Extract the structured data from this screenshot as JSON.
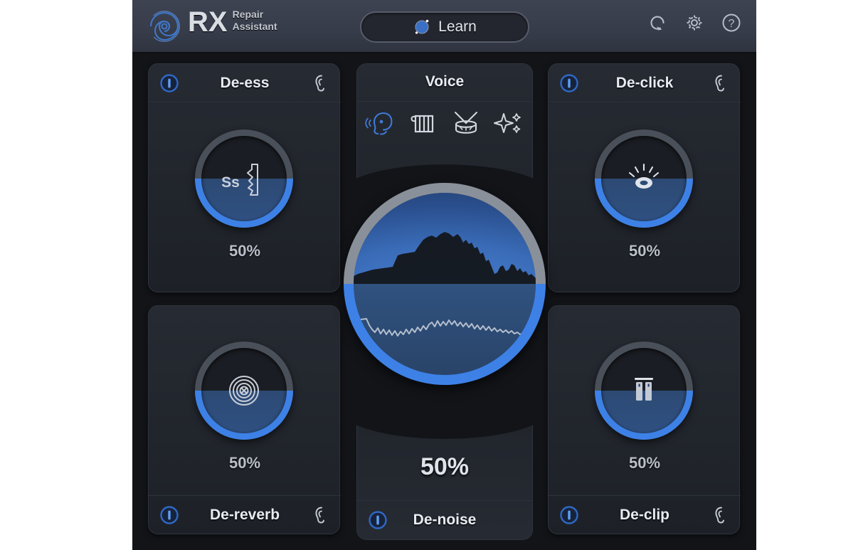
{
  "app": {
    "name": "RX Repair Assistant",
    "brand_accent": "#3d81e6",
    "background": "#121418",
    "header_background": "#373c4a"
  },
  "header": {
    "logo_mark": "rx-concentric-arcs-logo",
    "logo_primary": "RX",
    "logo_secondary_line1": "Repair",
    "logo_secondary_line2": "Assistant",
    "learn_button": {
      "label": "Learn",
      "icon": "learn-orb-icon"
    },
    "icons": [
      {
        "name": "reset-icon",
        "title": "Reset"
      },
      {
        "name": "gear-icon",
        "title": "Settings"
      },
      {
        "name": "help-icon",
        "title": "Help"
      }
    ]
  },
  "voice_panel": {
    "title": "Voice",
    "source_options": [
      {
        "name": "voice-icon",
        "label": "Voice",
        "selected": true
      },
      {
        "name": "piano-icon",
        "label": "Instrument",
        "selected": false
      },
      {
        "name": "drum-icon",
        "label": "Percussion",
        "selected": false
      },
      {
        "name": "sparkle-icon",
        "label": "Other",
        "selected": false
      }
    ]
  },
  "center_dial": {
    "ring_top_color": "#8a9099",
    "ring_bottom_color": "#3d81e6",
    "fill_percent": 50
  },
  "denoise_panel": {
    "value": "50%",
    "title": "De-noise",
    "power_on": true
  },
  "modules": [
    {
      "id": "de-ess",
      "position": "top-left",
      "title": "De-ess",
      "value": "50%",
      "percent": 50,
      "power_on": true,
      "power_icon": "power-icon",
      "solo_icon": "ear-icon",
      "knob_icon": "de-ess-icon",
      "bar_position": "top"
    },
    {
      "id": "de-click",
      "position": "top-right",
      "title": "De-click",
      "value": "50%",
      "percent": 50,
      "power_on": true,
      "power_icon": "power-icon",
      "solo_icon": "ear-icon",
      "knob_icon": "de-click-icon",
      "bar_position": "top"
    },
    {
      "id": "de-reverb",
      "position": "bottom-left",
      "title": "De-reverb",
      "value": "50%",
      "percent": 50,
      "power_on": true,
      "power_icon": "power-icon",
      "solo_icon": "ear-icon",
      "knob_icon": "de-reverb-icon",
      "bar_position": "bottom"
    },
    {
      "id": "de-clip",
      "position": "bottom-right",
      "title": "De-clip",
      "value": "50%",
      "percent": 50,
      "power_on": true,
      "power_icon": "power-icon",
      "solo_icon": "ear-icon",
      "knob_icon": "de-clip-icon",
      "bar_position": "bottom"
    }
  ]
}
